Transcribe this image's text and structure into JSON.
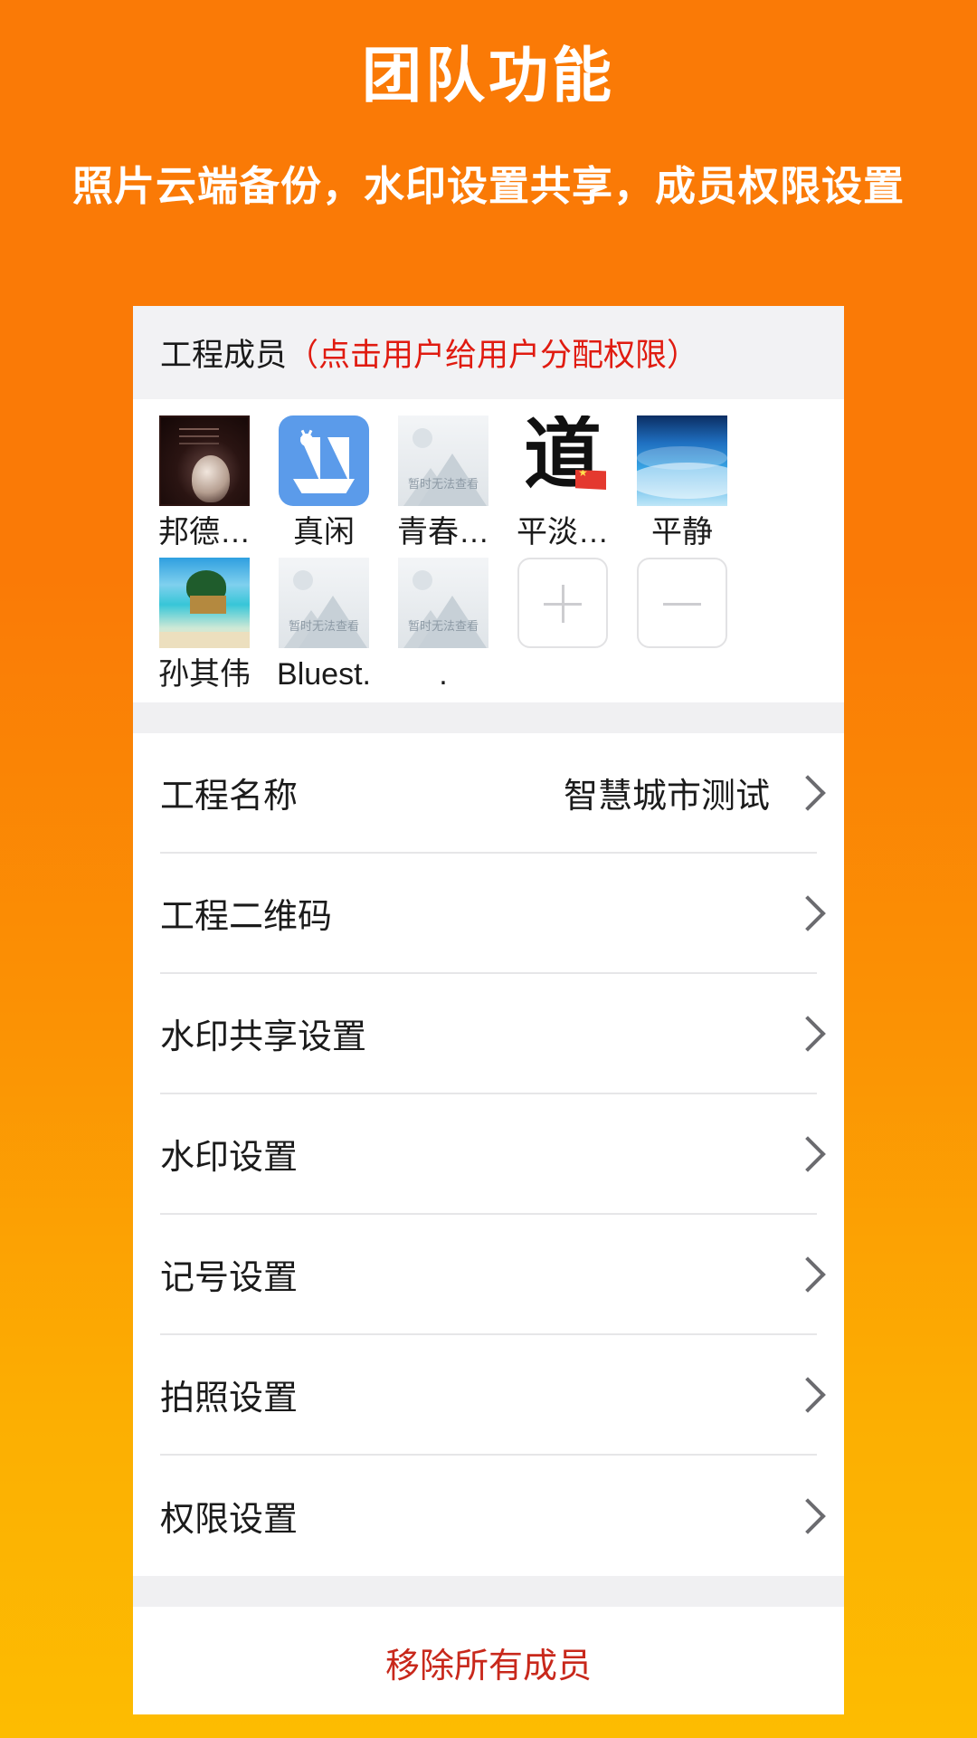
{
  "promo": {
    "title": "团队功能",
    "subtitle": "照片云端备份，水印设置共享，成员权限设置"
  },
  "colors": {
    "background_top": "#FA7A06",
    "background_bottom": "#FDBC01",
    "accent_red": "#e01b10",
    "danger_red": "#c8281b",
    "card_background": "#ffffff",
    "section_background": "#f0f0f2"
  },
  "members_section": {
    "title": "工程成员",
    "hint": "（点击用户给用户分配权限）",
    "placeholder_text": "暂时无法查看",
    "rows": [
      [
        {
          "name": "邦德…",
          "avatar": "portrait-photo"
        },
        {
          "name": "真闲",
          "avatar": "sailboat-icon"
        },
        {
          "name": "青春…",
          "avatar": "image-placeholder-icon"
        },
        {
          "name": "平淡…",
          "avatar": "dao-calligraphy"
        },
        {
          "name": "平静",
          "avatar": "ocean-wave-photo"
        }
      ],
      [
        {
          "name": "孙其伟",
          "avatar": "beach-photo"
        },
        {
          "name": "Bluest.",
          "avatar": "image-placeholder-icon"
        },
        {
          "name": ".",
          "avatar": "image-placeholder-icon"
        }
      ]
    ],
    "add_button_label": "+",
    "remove_button_label": "−"
  },
  "settings": {
    "items": [
      {
        "label": "工程名称",
        "value": "智慧城市测试"
      },
      {
        "label": "工程二维码",
        "value": ""
      },
      {
        "label": "水印共享设置",
        "value": ""
      },
      {
        "label": "水印设置",
        "value": ""
      },
      {
        "label": "记号设置",
        "value": ""
      },
      {
        "label": "拍照设置",
        "value": ""
      },
      {
        "label": "权限设置",
        "value": ""
      }
    ]
  },
  "footer": {
    "remove_all_label": "移除所有成员"
  }
}
